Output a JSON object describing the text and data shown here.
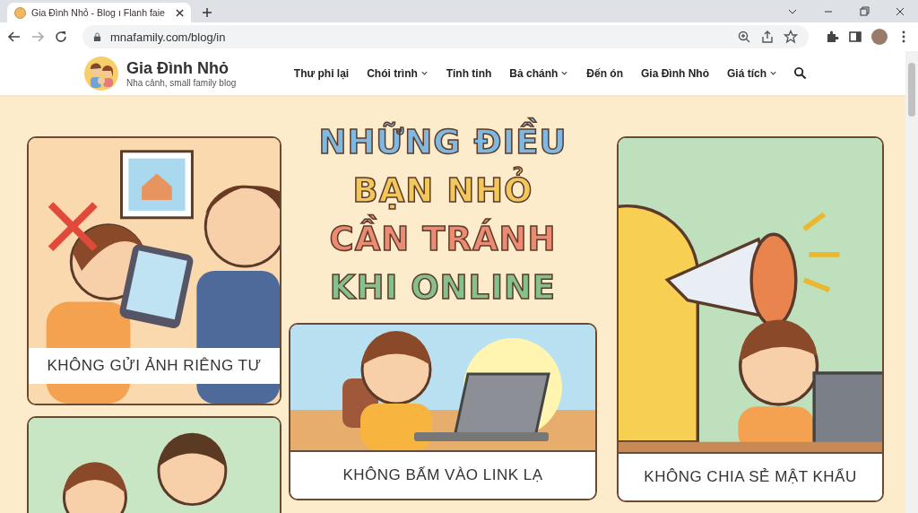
{
  "browser": {
    "tab_title": "Gia Đình Nhỏ - Blog ı Flanh faie",
    "address": "mnafamily.com/blog/in"
  },
  "site": {
    "name": "Gia Đình Nhỏ",
    "tagline": "Nha cảnh, small family blog",
    "nav": [
      {
        "label": "Thư phỉ lại",
        "dropdown": false
      },
      {
        "label": "Chói trình",
        "dropdown": true
      },
      {
        "label": "Tinh tinh",
        "dropdown": false
      },
      {
        "label": "Bả chánh",
        "dropdown": true
      },
      {
        "label": "Đến ón",
        "dropdown": false
      },
      {
        "label": "Gia Đình Nhỏ",
        "dropdown": false
      },
      {
        "label": "Giá tích",
        "dropdown": true
      }
    ]
  },
  "headline": [
    {
      "text": "NHỮNG ĐIỀU",
      "color": "#7fb8e0"
    },
    {
      "text": "BẠN NHỎ",
      "color": "#f2c85a"
    },
    {
      "text": "CẦN TRÁNH",
      "color": "#ec8a72"
    },
    {
      "text": "KHI ONLINE",
      "color": "#86c08c"
    }
  ],
  "cards": [
    {
      "caption": "KHÔNG GỬI ẢNH RIÊNG TƯ",
      "kind": "lefttop"
    },
    {
      "caption": "KHÔNG BẤM VÀO LINK LẠ",
      "kind": "center"
    },
    {
      "caption": "KHÔNG CHIA SẺ MẬT KHẨU",
      "kind": "right"
    },
    {
      "kind": "leftbottom"
    }
  ]
}
